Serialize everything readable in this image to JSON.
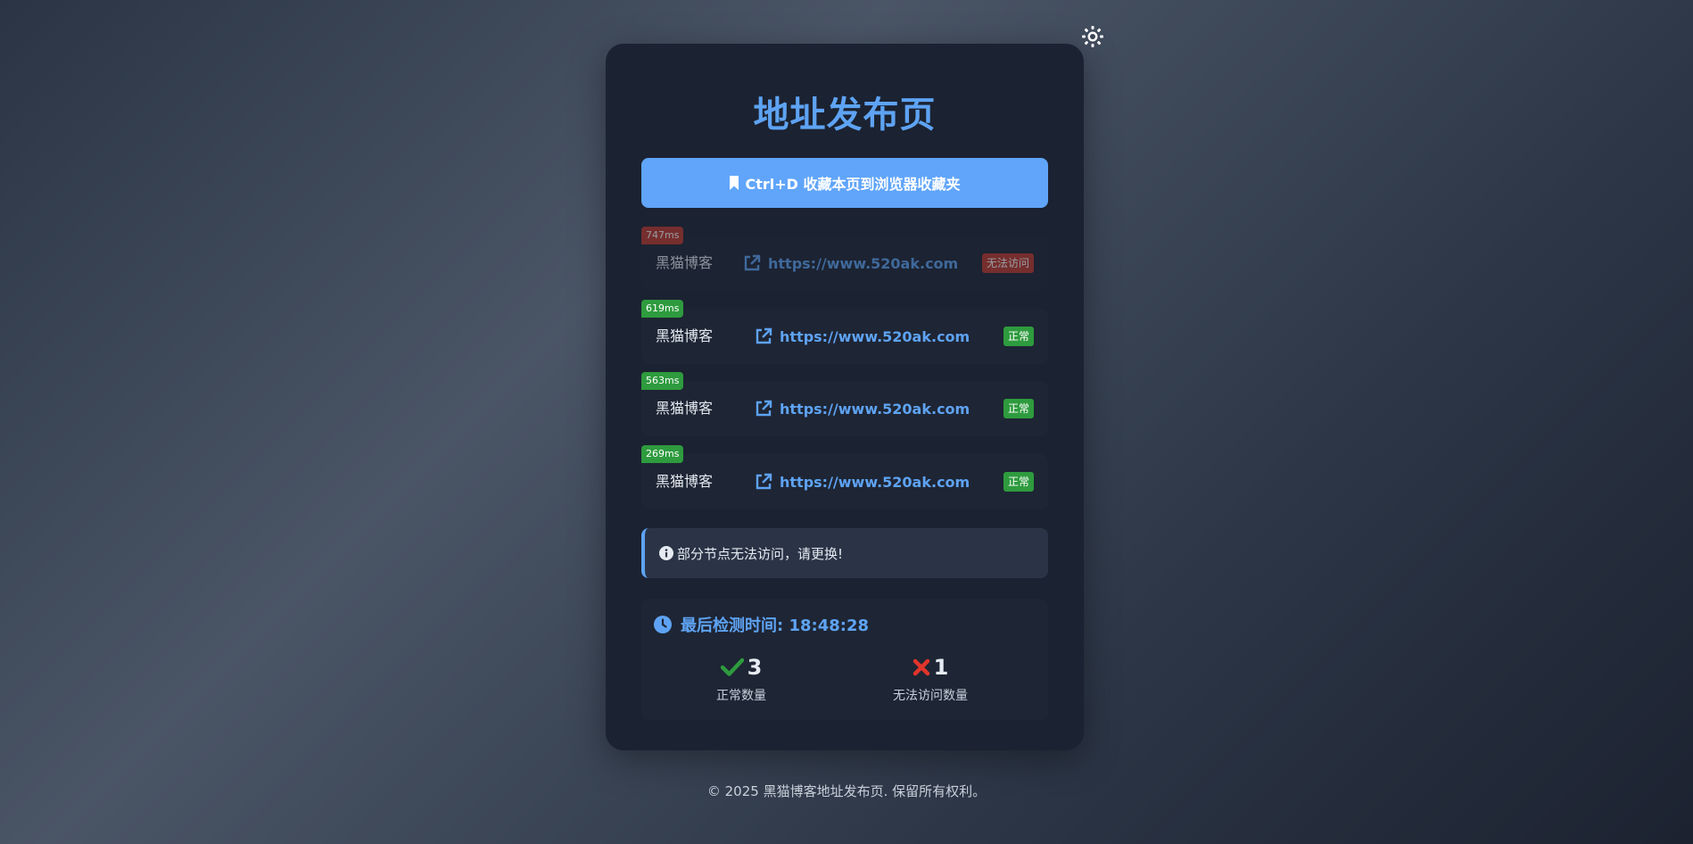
{
  "page_title": "地址发布页",
  "bookmark_button": {
    "label": "Ctrl+D 收藏本页到浏览器收藏夹"
  },
  "links": [
    {
      "latency": "747ms",
      "name": "黑猫博客",
      "url": "https://www.520ak.com",
      "status": "无法访问",
      "ok": false
    },
    {
      "latency": "619ms",
      "name": "黑猫博客",
      "url": "https://www.520ak.com",
      "status": "正常",
      "ok": true
    },
    {
      "latency": "563ms",
      "name": "黑猫博客",
      "url": "https://www.520ak.com",
      "status": "正常",
      "ok": true
    },
    {
      "latency": "269ms",
      "name": "黑猫博客",
      "url": "https://www.520ak.com",
      "status": "正常",
      "ok": true
    }
  ],
  "notice": {
    "text": "部分节点无法访问，请更换!"
  },
  "stats": {
    "last_check_label": "最后检测时间: 18:48:28",
    "ok_count": "3",
    "ok_label": "正常数量",
    "fail_count": "1",
    "fail_label": "无法访问数量"
  },
  "footer": {
    "text": "© 2025 黑猫博客地址发布页. 保留所有权利。"
  },
  "colors": {
    "accent": "#5ea3f3",
    "ok": "#2e9b3e",
    "bad": "#c0392b",
    "card": "#1b2231"
  },
  "icons": {
    "theme": "sun-icon",
    "bookmark": "bookmark-icon",
    "link": "external-link-icon",
    "notice": "info-circle-icon",
    "clock": "clock-icon",
    "ok": "check-icon",
    "fail": "cross-icon"
  }
}
